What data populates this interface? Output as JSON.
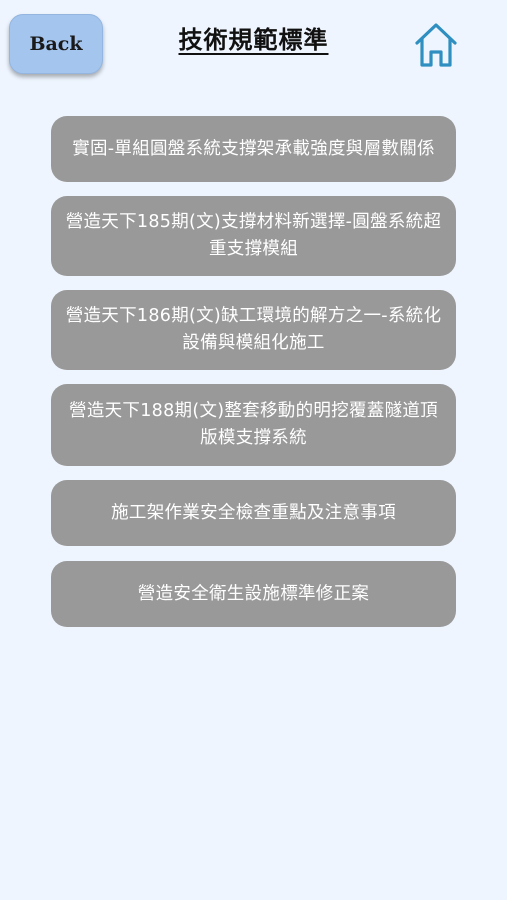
{
  "header": {
    "back_label": "Back",
    "title": "技術規範標準",
    "home_icon": "home-icon"
  },
  "menu": {
    "items": [
      {
        "label": "實固-單組圓盤系統支撐架承載強度與層數關係"
      },
      {
        "label": "營造天下185期(文)支撐材料新選擇-圓盤系統超重支撐模組"
      },
      {
        "label": "營造天下186期(文)缺工環境的解方之一-系統化設備與模組化施工"
      },
      {
        "label": "營造天下188期(文)整套移動的明挖覆蓋隧道頂版模支撐系統"
      },
      {
        "label": "施工架作業安全檢查重點及注意事項"
      },
      {
        "label": "營造安全衛生設施標準修正案"
      }
    ]
  },
  "colors": {
    "background": "#eef5fe",
    "back_button": "#a3c5ee",
    "menu_item": "#999999",
    "home_icon": "#2e8fc0"
  }
}
